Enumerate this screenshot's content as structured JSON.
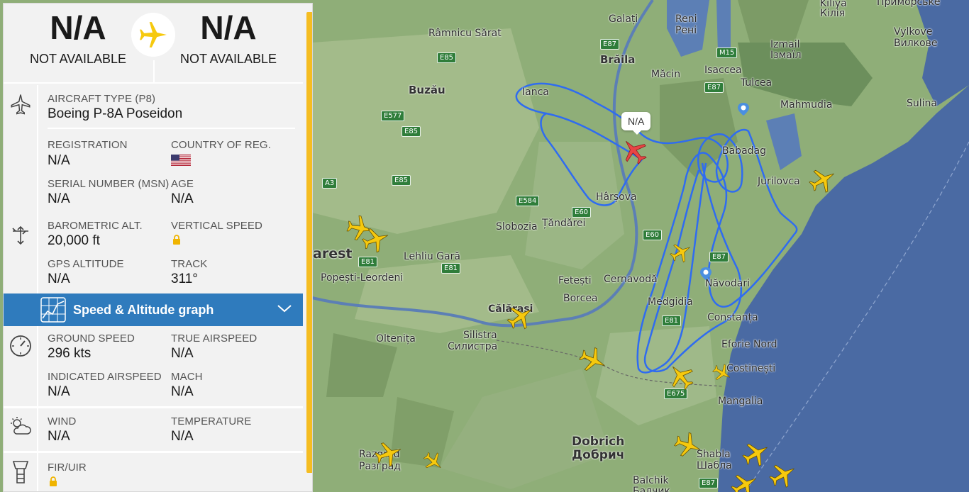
{
  "route": {
    "origin_code": "N/A",
    "origin_name": "NOT AVAILABLE",
    "destination_code": "N/A",
    "destination_name": "NOT AVAILABLE"
  },
  "aircraft": {
    "type_label": "AIRCRAFT TYPE",
    "type_code": "(P8)",
    "type_name": "Boeing P-8A Poseidon",
    "registration_label": "REGISTRATION",
    "registration": "N/A",
    "country_label": "COUNTRY OF REG.",
    "country_flag": "us-flag-icon",
    "serial_label": "SERIAL NUMBER (MSN)",
    "serial": "N/A",
    "age_label": "AGE",
    "age": "N/A"
  },
  "altitude": {
    "baro_label": "BAROMETRIC ALT.",
    "baro": "20,000 ft",
    "vspeed_label": "VERTICAL SPEED",
    "vspeed_locked": true,
    "gps_label": "GPS ALTITUDE",
    "gps": "N/A",
    "track_label": "TRACK",
    "track": "311°"
  },
  "graph": {
    "label": "Speed & Altitude graph"
  },
  "speed": {
    "ground_label": "GROUND SPEED",
    "ground": "296 kts",
    "tas_label": "TRUE AIRSPEED",
    "tas": "N/A",
    "ias_label": "INDICATED AIRSPEED",
    "ias": "N/A",
    "mach_label": "MACH",
    "mach": "N/A"
  },
  "weather": {
    "wind_label": "WIND",
    "wind": "N/A",
    "temp_label": "TEMPERATURE",
    "temp": "N/A"
  },
  "fir": {
    "label": "FIR/UIR",
    "locked": true
  },
  "map": {
    "tooltip": "N/A",
    "colors": {
      "track": "#2f6cf0",
      "land": "#8fae78",
      "sea": "#4a6aa3",
      "selected_plane": "#e84545",
      "plane": "#f6c90e"
    },
    "places": [
      {
        "id": "galati",
        "text": "Galați"
      },
      {
        "id": "reni",
        "text": "Reni"
      },
      {
        "id": "reni-cyr",
        "text": "Рені"
      },
      {
        "id": "kiliya",
        "text": "Kiliya"
      },
      {
        "id": "kiliya-cyr",
        "text": "Кілія"
      },
      {
        "id": "prymorske",
        "text": "Приморське"
      },
      {
        "id": "ramnicu",
        "text": "Râmnicu Sărat"
      },
      {
        "id": "braila",
        "text": "Brăila"
      },
      {
        "id": "macin",
        "text": "Măcin"
      },
      {
        "id": "isaccea",
        "text": "Isaccea"
      },
      {
        "id": "izmail",
        "text": "Izmail"
      },
      {
        "id": "izmail-cyr",
        "text": "Ізмаїл"
      },
      {
        "id": "vylkove",
        "text": "Vylkove"
      },
      {
        "id": "vylkove-cyr",
        "text": "Вилкове"
      },
      {
        "id": "buzau",
        "text": "Buzău"
      },
      {
        "id": "ianca",
        "text": "Ianca"
      },
      {
        "id": "tulcea",
        "text": "Tulcea"
      },
      {
        "id": "mahmudia",
        "text": "Mahmudia"
      },
      {
        "id": "sulina",
        "text": "Sulina"
      },
      {
        "id": "babadag",
        "text": "Babadag"
      },
      {
        "id": "jurilovca",
        "text": "Jurilovca"
      },
      {
        "id": "harsova",
        "text": "Hârșova"
      },
      {
        "id": "slobozia",
        "text": "Slobozia"
      },
      {
        "id": "tandarei",
        "text": "Țăndărei"
      },
      {
        "id": "lehliu",
        "text": "Lehliu Gară"
      },
      {
        "id": "arest",
        "text": "arest"
      },
      {
        "id": "popesti",
        "text": "Popești-Leordeni"
      },
      {
        "id": "fetesti",
        "text": "Fetești"
      },
      {
        "id": "cernavoda",
        "text": "Cernavodă"
      },
      {
        "id": "navodari",
        "text": "Năvodari"
      },
      {
        "id": "borcea",
        "text": "Borcea"
      },
      {
        "id": "medgidia",
        "text": "Medgidia"
      },
      {
        "id": "calarasi",
        "text": "Călărași"
      },
      {
        "id": "constanta",
        "text": "Constanța"
      },
      {
        "id": "oltenita",
        "text": "Oltenița"
      },
      {
        "id": "silistra",
        "text": "Silistra"
      },
      {
        "id": "silistra-cyr",
        "text": "Силистра"
      },
      {
        "id": "eforie",
        "text": "Eforie Nord"
      },
      {
        "id": "costinesti",
        "text": "Costinești"
      },
      {
        "id": "mangalia",
        "text": "Mangalia"
      },
      {
        "id": "dobrich",
        "text": "Dobrich"
      },
      {
        "id": "dobrich-cyr",
        "text": "Добрич"
      },
      {
        "id": "razgrad",
        "text": "Razgrad"
      },
      {
        "id": "razgrad-cyr",
        "text": "Разград"
      },
      {
        "id": "shabla",
        "text": "Shabla"
      },
      {
        "id": "shabla-cyr",
        "text": "Шабла"
      },
      {
        "id": "balchik",
        "text": "Balchik"
      },
      {
        "id": "balchik-cyr",
        "text": "Балчик"
      }
    ],
    "roads": [
      {
        "id": "e87a",
        "text": "E87"
      },
      {
        "id": "m15",
        "text": "M15"
      },
      {
        "id": "e85a",
        "text": "E85"
      },
      {
        "id": "e87b",
        "text": "E87"
      },
      {
        "id": "e577",
        "text": "E577"
      },
      {
        "id": "e85b",
        "text": "E85"
      },
      {
        "id": "e85c",
        "text": "E85"
      },
      {
        "id": "a3",
        "text": "A3"
      },
      {
        "id": "e584",
        "text": "E584"
      },
      {
        "id": "e60a",
        "text": "E60"
      },
      {
        "id": "e60b",
        "text": "E60"
      },
      {
        "id": "e87c",
        "text": "E87"
      },
      {
        "id": "e81a",
        "text": "E81"
      },
      {
        "id": "e81b",
        "text": "E81"
      },
      {
        "id": "e81c",
        "text": "E81"
      },
      {
        "id": "e675",
        "text": "E675"
      },
      {
        "id": "e87d",
        "text": "E87"
      }
    ]
  }
}
